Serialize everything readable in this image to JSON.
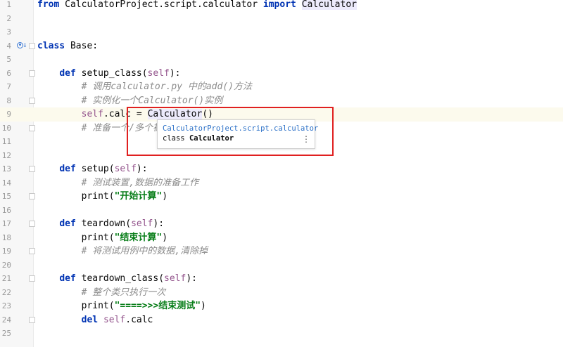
{
  "editor": {
    "lines": [
      {
        "n": "1",
        "parts": [
          {
            "t": "from",
            "c": "kw"
          },
          {
            "t": " CalculatorProject.script.calculator "
          },
          {
            "t": "import",
            "c": "kw"
          },
          {
            "t": " "
          },
          {
            "t": "Calculator",
            "c": "hl"
          }
        ]
      },
      {
        "n": "2",
        "parts": []
      },
      {
        "n": "3",
        "parts": []
      },
      {
        "n": "4",
        "parts": [
          {
            "t": "class",
            "c": "kw"
          },
          {
            "t": " Base:"
          }
        ]
      },
      {
        "n": "5",
        "parts": []
      },
      {
        "n": "6",
        "parts": [
          {
            "t": "    "
          },
          {
            "t": "def",
            "c": "kw"
          },
          {
            "t": " setup_class("
          },
          {
            "t": "self",
            "c": "self"
          },
          {
            "t": "):"
          }
        ]
      },
      {
        "n": "7",
        "parts": [
          {
            "t": "        "
          },
          {
            "t": "# 调用calculator.py 中的add()方法",
            "c": "cm"
          }
        ]
      },
      {
        "n": "8",
        "parts": [
          {
            "t": "        "
          },
          {
            "t": "# 实例化一个Calculator()实例",
            "c": "cm"
          }
        ]
      },
      {
        "n": "9",
        "parts": [
          {
            "t": "        "
          },
          {
            "t": "self",
            "c": "self"
          },
          {
            "t": ".calc = "
          },
          {
            "t": "Calcu",
            "c": "hl"
          },
          {
            "caret": true
          },
          {
            "t": "lator",
            "c": "hl"
          },
          {
            "t": "()"
          }
        ]
      },
      {
        "n": "10",
        "parts": [
          {
            "t": "        "
          },
          {
            "t": "# 准备一个/多个被测数",
            "c": "cm"
          }
        ]
      },
      {
        "n": "11",
        "parts": []
      },
      {
        "n": "12",
        "parts": []
      },
      {
        "n": "13",
        "parts": [
          {
            "t": "    "
          },
          {
            "t": "def",
            "c": "kw"
          },
          {
            "t": " setup("
          },
          {
            "t": "self",
            "c": "self"
          },
          {
            "t": "):"
          }
        ]
      },
      {
        "n": "14",
        "parts": [
          {
            "t": "        "
          },
          {
            "t": "# 测试装置,数据的准备工作",
            "c": "cm"
          }
        ]
      },
      {
        "n": "15",
        "parts": [
          {
            "t": "        print("
          },
          {
            "t": "\"开始计算\"",
            "c": "str"
          },
          {
            "t": ")"
          }
        ]
      },
      {
        "n": "16",
        "parts": []
      },
      {
        "n": "17",
        "parts": [
          {
            "t": "    "
          },
          {
            "t": "def",
            "c": "kw"
          },
          {
            "t": " teardown("
          },
          {
            "t": "self",
            "c": "self"
          },
          {
            "t": "):"
          }
        ]
      },
      {
        "n": "18",
        "parts": [
          {
            "t": "        print("
          },
          {
            "t": "\"结束计算\"",
            "c": "str"
          },
          {
            "t": ")"
          }
        ]
      },
      {
        "n": "19",
        "parts": [
          {
            "t": "        "
          },
          {
            "t": "# 将测试用例中的数据,清除掉",
            "c": "cm"
          }
        ]
      },
      {
        "n": "20",
        "parts": []
      },
      {
        "n": "21",
        "parts": [
          {
            "t": "    "
          },
          {
            "t": "def",
            "c": "kw"
          },
          {
            "t": " teardown_class("
          },
          {
            "t": "self",
            "c": "self"
          },
          {
            "t": "):"
          }
        ]
      },
      {
        "n": "22",
        "parts": [
          {
            "t": "        "
          },
          {
            "t": "# 整个类只执行一次",
            "c": "cm"
          }
        ]
      },
      {
        "n": "23",
        "parts": [
          {
            "t": "        print("
          },
          {
            "t": "\"====>>>结束测试\"",
            "c": "str"
          },
          {
            "t": ")"
          }
        ]
      },
      {
        "n": "24",
        "parts": [
          {
            "t": "        "
          },
          {
            "t": "del",
            "c": "kw"
          },
          {
            "t": " "
          },
          {
            "t": "self",
            "c": "self"
          },
          {
            "t": ".calc"
          }
        ]
      },
      {
        "n": "25",
        "parts": []
      }
    ],
    "current_line": "9"
  },
  "popup": {
    "package": "CalculatorProject.script.calculator",
    "class_keyword": "class",
    "class_name": "Calculator",
    "more_icon": "⋮"
  },
  "colors": {
    "keyword": "#0033b3",
    "self": "#94558d",
    "comment": "#8c8c8c",
    "string": "#067d17",
    "highlight_box": "#e02020"
  },
  "icons": {
    "line4_gutter": "implemented-by-icon"
  }
}
